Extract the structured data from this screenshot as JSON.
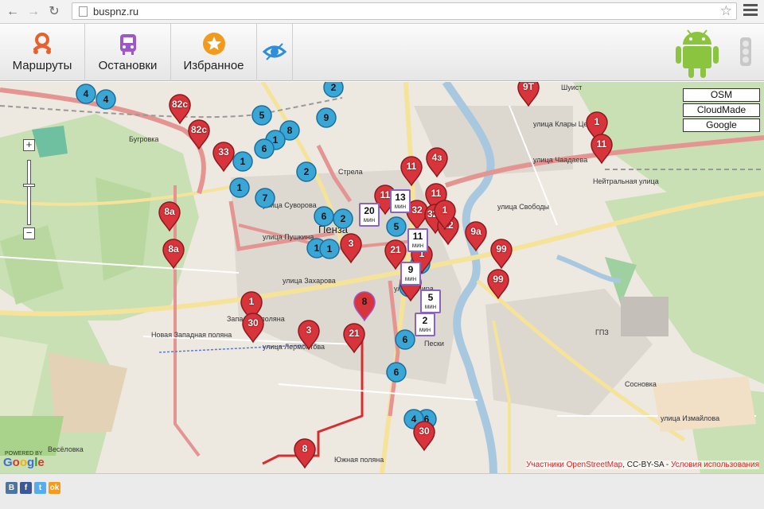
{
  "browser": {
    "url": "buspnz.ru"
  },
  "toolbar": {
    "routes_label": "Маршруты",
    "stops_label": "Остановки",
    "favorites_label": "Избранное"
  },
  "map_layers": [
    "OSM",
    "CloudMade",
    "Google"
  ],
  "map_labels": {
    "city": "Пенза",
    "places": [
      {
        "text": "Бугровка"
      },
      {
        "text": "Шуист"
      },
      {
        "text": "Стрела"
      },
      {
        "text": "Западная поляна"
      },
      {
        "text": "Новая Западная поляна"
      },
      {
        "text": "Пески"
      },
      {
        "text": "ГПЗ"
      },
      {
        "text": "Сосновка"
      },
      {
        "text": "Весёловка"
      },
      {
        "text": "Южная поляна"
      },
      {
        "text": "улица Клары Цеткин"
      },
      {
        "text": "улица Чаадаева"
      },
      {
        "text": "улица Свободы"
      },
      {
        "text": "улица Суворова"
      },
      {
        "text": "улица Пушкина"
      },
      {
        "text": "улица Захарова"
      },
      {
        "text": "улица Измайлова"
      },
      {
        "text": "улица Лермонтова"
      },
      {
        "text": "улица Мира"
      },
      {
        "text": "Нейтральная улица"
      }
    ]
  },
  "markers": {
    "red": [
      {
        "label": "9Т"
      },
      {
        "label": "82с"
      },
      {
        "label": "82с"
      },
      {
        "label": "33"
      },
      {
        "label": "8а"
      },
      {
        "label": "8а"
      },
      {
        "label": "1"
      },
      {
        "label": "11"
      },
      {
        "label": "11"
      },
      {
        "label": "4з"
      },
      {
        "label": "11"
      },
      {
        "label": "11"
      },
      {
        "label": "32"
      },
      {
        "label": "32с"
      },
      {
        "label": "22"
      },
      {
        "label": "9а"
      },
      {
        "label": "99"
      },
      {
        "label": "99"
      },
      {
        "label": "3"
      },
      {
        "label": "21"
      },
      {
        "label": "1"
      },
      {
        "label": "30"
      },
      {
        "label": "3"
      },
      {
        "label": "21"
      },
      {
        "label": "30"
      },
      {
        "label": "8"
      },
      {
        "label": "8"
      },
      {
        "label": "1"
      },
      {
        "label": "1"
      }
    ],
    "blue": [
      {
        "label": "4"
      },
      {
        "label": "4"
      },
      {
        "label": "2"
      },
      {
        "label": "5"
      },
      {
        "label": "9"
      },
      {
        "label": "8"
      },
      {
        "label": "1"
      },
      {
        "label": "6"
      },
      {
        "label": "1"
      },
      {
        "label": "2"
      },
      {
        "label": "1"
      },
      {
        "label": "7"
      },
      {
        "label": "6"
      },
      {
        "label": "2"
      },
      {
        "label": "1"
      },
      {
        "label": "1"
      },
      {
        "label": "5"
      },
      {
        "label": "1"
      },
      {
        "label": "2"
      },
      {
        "label": "6"
      },
      {
        "label": "6"
      },
      {
        "label": "6"
      },
      {
        "label": "4"
      }
    ],
    "selected": {
      "label": "8"
    }
  },
  "arrivals": [
    {
      "value": "13",
      "unit": "мин"
    },
    {
      "value": "20",
      "unit": "мин"
    },
    {
      "value": "11",
      "unit": "мин"
    },
    {
      "value": "9",
      "unit": "мин"
    },
    {
      "value": "5",
      "unit": "мин"
    },
    {
      "value": "2",
      "unit": "мин"
    }
  ],
  "attribution": {
    "contributors": "Участники OpenStreetMap",
    "license": ", CC-BY-SA - ",
    "terms": "Условия использования"
  },
  "google_logo": "Google",
  "powered_by": "POWERED BY",
  "social": [
    {
      "text": "В",
      "color": "#4c75a3"
    },
    {
      "text": "f",
      "color": "#3b5998"
    },
    {
      "text": "t",
      "color": "#55acee"
    },
    {
      "text": "ok",
      "color": "#f59a1b"
    }
  ]
}
